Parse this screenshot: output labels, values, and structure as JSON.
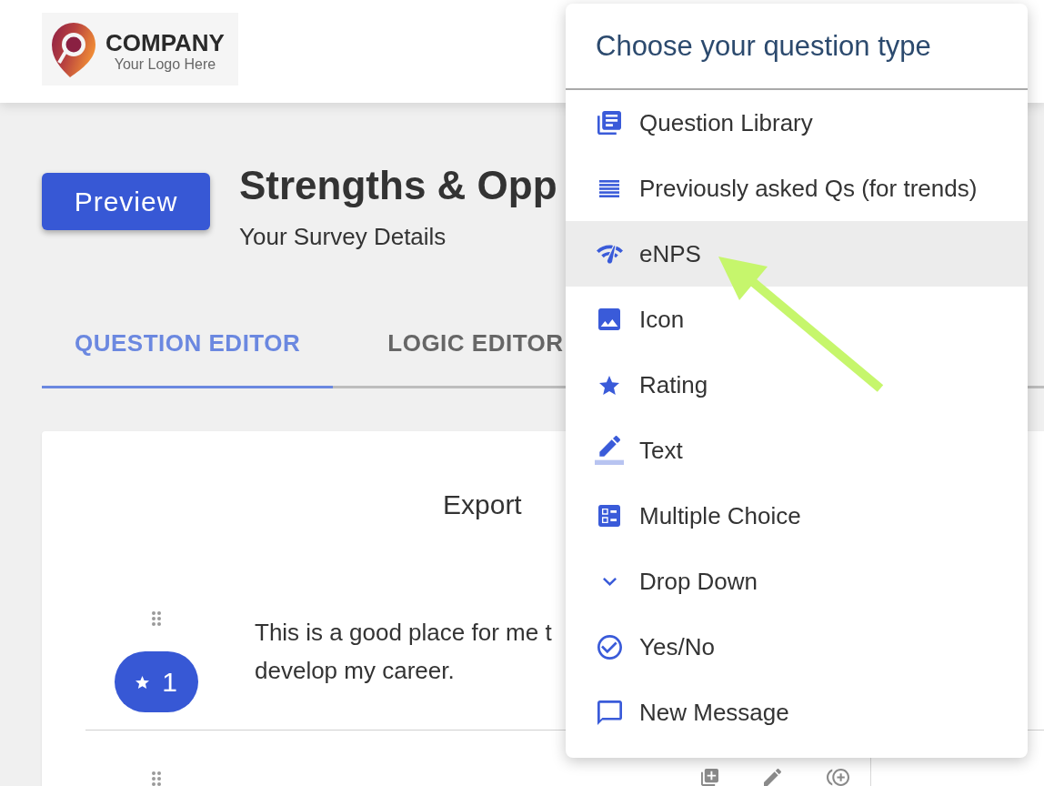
{
  "header": {
    "logo": {
      "name": "COMPANY",
      "tagline": "Your Logo Here"
    }
  },
  "survey": {
    "preview_button": "Preview",
    "title": "Strengths & Opp",
    "subtitle": "Your Survey Details"
  },
  "tabs": [
    {
      "label": "QUESTION EDITOR",
      "selected": true
    },
    {
      "label": "LOGIC EDITOR",
      "selected": false
    }
  ],
  "editor": {
    "export_button": "Export",
    "questions": [
      {
        "kind": "rating",
        "number": "1",
        "lines": [
          "This is a good place for me t",
          "develop my career."
        ]
      },
      {
        "actions": [
          {
            "kind": "add"
          },
          {
            "kind": "edit"
          },
          {
            "kind": "duplicate"
          }
        ]
      }
    ]
  },
  "question_type_menu": {
    "title": "Choose your question type",
    "items": [
      {
        "kind": "library",
        "label": "Question Library",
        "selected": false
      },
      {
        "kind": "history",
        "label": "Previously asked Qs (for trends)",
        "selected": false
      },
      {
        "kind": "enps",
        "label": "eNPS",
        "selected": true
      },
      {
        "kind": "image",
        "label": "Icon",
        "selected": false
      },
      {
        "kind": "rating",
        "label": "Rating",
        "selected": false
      },
      {
        "kind": "text",
        "label": "Text",
        "selected": false
      },
      {
        "kind": "multiple_choice",
        "label": "Multiple Choice",
        "selected": false
      },
      {
        "kind": "dropdown",
        "label": "Drop Down",
        "selected": false
      },
      {
        "kind": "yes_no",
        "label": "Yes/No",
        "selected": false
      },
      {
        "kind": "message",
        "label": "New Message",
        "selected": false
      }
    ]
  }
}
